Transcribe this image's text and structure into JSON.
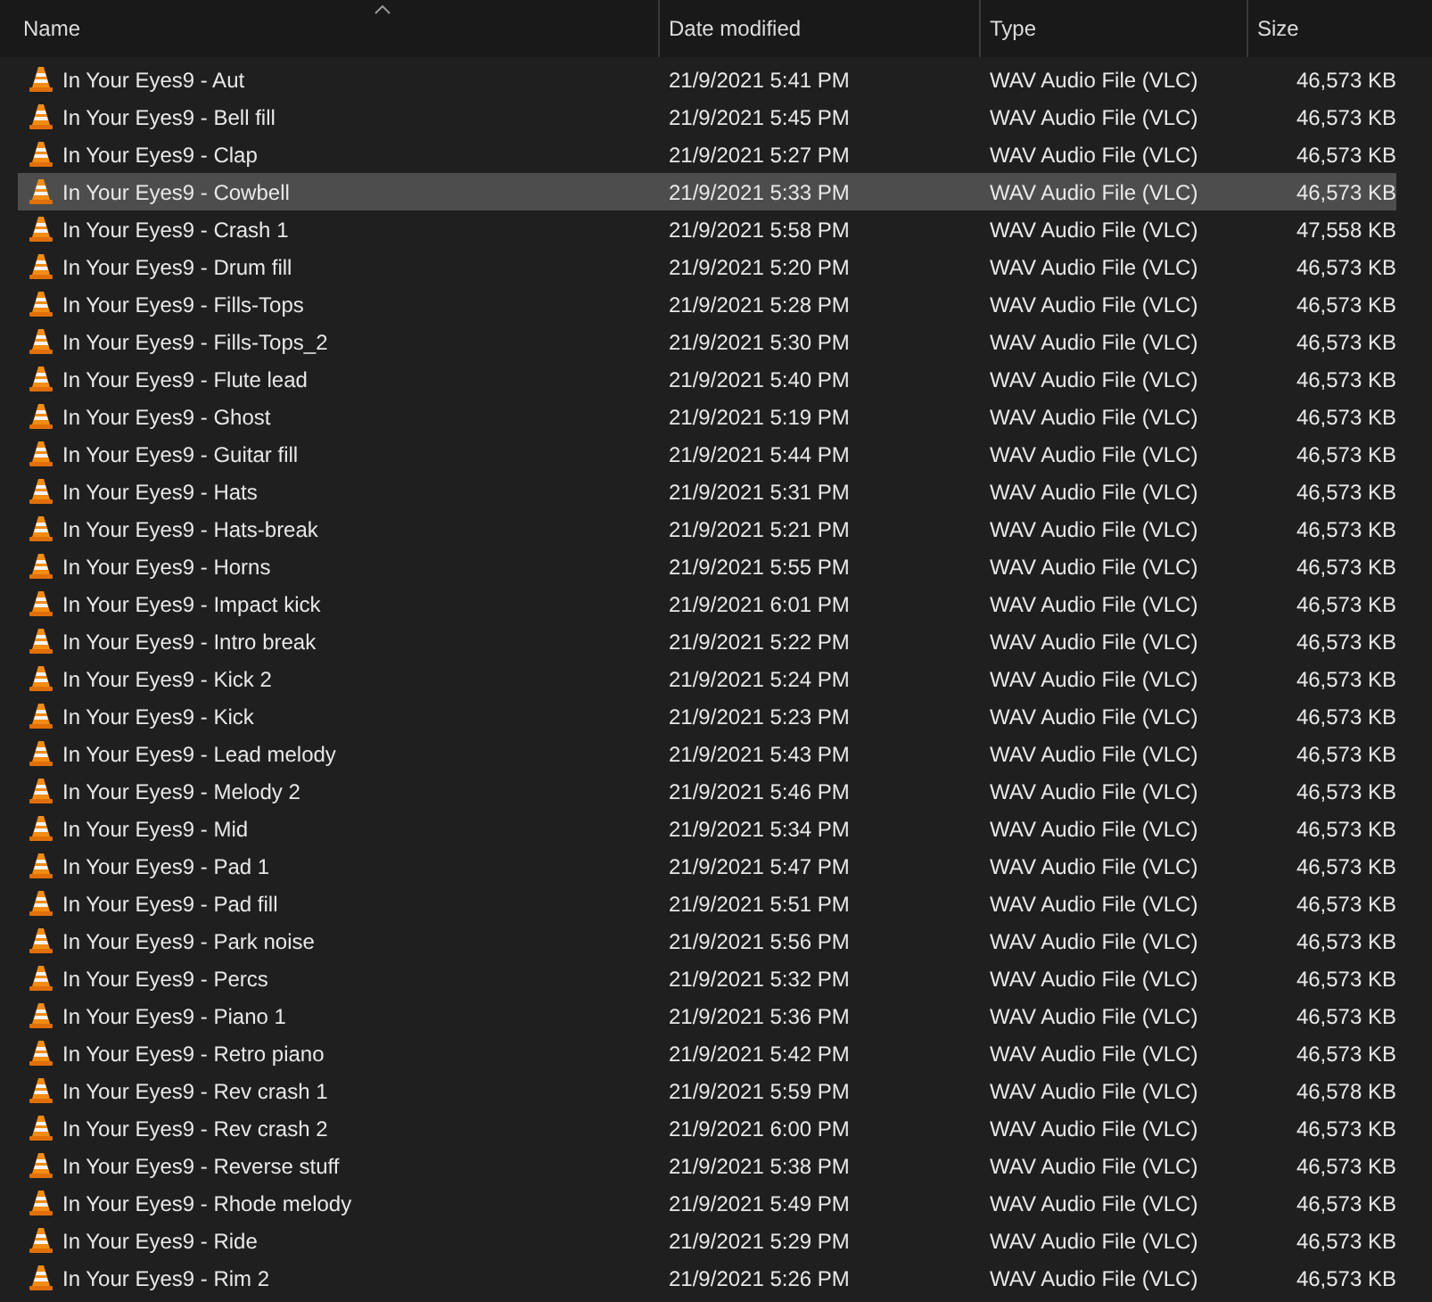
{
  "columns": [
    {
      "label": "Name",
      "sorted": true
    },
    {
      "label": "Date modified",
      "sorted": false
    },
    {
      "label": "Type",
      "sorted": false
    },
    {
      "label": "Size",
      "sorted": false
    }
  ],
  "rows": [
    {
      "name": "In Your Eyes9 - Aut",
      "date": "21/9/2021 5:41 PM",
      "type": "WAV Audio File (VLC)",
      "size": "46,573 KB",
      "selected": false
    },
    {
      "name": "In Your Eyes9 - Bell fill",
      "date": "21/9/2021 5:45 PM",
      "type": "WAV Audio File (VLC)",
      "size": "46,573 KB",
      "selected": false
    },
    {
      "name": "In Your Eyes9 - Clap",
      "date": "21/9/2021 5:27 PM",
      "type": "WAV Audio File (VLC)",
      "size": "46,573 KB",
      "selected": false
    },
    {
      "name": "In Your Eyes9 - Cowbell",
      "date": "21/9/2021 5:33 PM",
      "type": "WAV Audio File (VLC)",
      "size": "46,573 KB",
      "selected": true
    },
    {
      "name": "In Your Eyes9 - Crash 1",
      "date": "21/9/2021 5:58 PM",
      "type": "WAV Audio File (VLC)",
      "size": "47,558 KB",
      "selected": false
    },
    {
      "name": "In Your Eyes9 - Drum fill",
      "date": "21/9/2021 5:20 PM",
      "type": "WAV Audio File (VLC)",
      "size": "46,573 KB",
      "selected": false
    },
    {
      "name": "In Your Eyes9 - Fills-Tops",
      "date": "21/9/2021 5:28 PM",
      "type": "WAV Audio File (VLC)",
      "size": "46,573 KB",
      "selected": false
    },
    {
      "name": "In Your Eyes9 - Fills-Tops_2",
      "date": "21/9/2021 5:30 PM",
      "type": "WAV Audio File (VLC)",
      "size": "46,573 KB",
      "selected": false
    },
    {
      "name": "In Your Eyes9 - Flute lead",
      "date": "21/9/2021 5:40 PM",
      "type": "WAV Audio File (VLC)",
      "size": "46,573 KB",
      "selected": false
    },
    {
      "name": "In Your Eyes9 - Ghost",
      "date": "21/9/2021 5:19 PM",
      "type": "WAV Audio File (VLC)",
      "size": "46,573 KB",
      "selected": false
    },
    {
      "name": "In Your Eyes9 - Guitar fill",
      "date": "21/9/2021 5:44 PM",
      "type": "WAV Audio File (VLC)",
      "size": "46,573 KB",
      "selected": false
    },
    {
      "name": "In Your Eyes9 - Hats",
      "date": "21/9/2021 5:31 PM",
      "type": "WAV Audio File (VLC)",
      "size": "46,573 KB",
      "selected": false
    },
    {
      "name": "In Your Eyes9 - Hats-break",
      "date": "21/9/2021 5:21 PM",
      "type": "WAV Audio File (VLC)",
      "size": "46,573 KB",
      "selected": false
    },
    {
      "name": "In Your Eyes9 - Horns",
      "date": "21/9/2021 5:55 PM",
      "type": "WAV Audio File (VLC)",
      "size": "46,573 KB",
      "selected": false
    },
    {
      "name": "In Your Eyes9 - Impact kick",
      "date": "21/9/2021 6:01 PM",
      "type": "WAV Audio File (VLC)",
      "size": "46,573 KB",
      "selected": false
    },
    {
      "name": "In Your Eyes9 - Intro break",
      "date": "21/9/2021 5:22 PM",
      "type": "WAV Audio File (VLC)",
      "size": "46,573 KB",
      "selected": false
    },
    {
      "name": "In Your Eyes9 - Kick 2",
      "date": "21/9/2021 5:24 PM",
      "type": "WAV Audio File (VLC)",
      "size": "46,573 KB",
      "selected": false
    },
    {
      "name": "In Your Eyes9 - Kick",
      "date": "21/9/2021 5:23 PM",
      "type": "WAV Audio File (VLC)",
      "size": "46,573 KB",
      "selected": false
    },
    {
      "name": "In Your Eyes9 - Lead melody",
      "date": "21/9/2021 5:43 PM",
      "type": "WAV Audio File (VLC)",
      "size": "46,573 KB",
      "selected": false
    },
    {
      "name": "In Your Eyes9 - Melody 2",
      "date": "21/9/2021 5:46 PM",
      "type": "WAV Audio File (VLC)",
      "size": "46,573 KB",
      "selected": false
    },
    {
      "name": "In Your Eyes9 - Mid",
      "date": "21/9/2021 5:34 PM",
      "type": "WAV Audio File (VLC)",
      "size": "46,573 KB",
      "selected": false
    },
    {
      "name": "In Your Eyes9 - Pad 1",
      "date": "21/9/2021 5:47 PM",
      "type": "WAV Audio File (VLC)",
      "size": "46,573 KB",
      "selected": false
    },
    {
      "name": "In Your Eyes9 - Pad fill",
      "date": "21/9/2021 5:51 PM",
      "type": "WAV Audio File (VLC)",
      "size": "46,573 KB",
      "selected": false
    },
    {
      "name": "In Your Eyes9 - Park noise",
      "date": "21/9/2021 5:56 PM",
      "type": "WAV Audio File (VLC)",
      "size": "46,573 KB",
      "selected": false
    },
    {
      "name": "In Your Eyes9 - Percs",
      "date": "21/9/2021 5:32 PM",
      "type": "WAV Audio File (VLC)",
      "size": "46,573 KB",
      "selected": false
    },
    {
      "name": "In Your Eyes9 - Piano 1",
      "date": "21/9/2021 5:36 PM",
      "type": "WAV Audio File (VLC)",
      "size": "46,573 KB",
      "selected": false
    },
    {
      "name": "In Your Eyes9 - Retro piano",
      "date": "21/9/2021 5:42 PM",
      "type": "WAV Audio File (VLC)",
      "size": "46,573 KB",
      "selected": false
    },
    {
      "name": "In Your Eyes9 - Rev crash 1",
      "date": "21/9/2021 5:59 PM",
      "type": "WAV Audio File (VLC)",
      "size": "46,578 KB",
      "selected": false
    },
    {
      "name": "In Your Eyes9 - Rev crash 2",
      "date": "21/9/2021 6:00 PM",
      "type": "WAV Audio File (VLC)",
      "size": "46,573 KB",
      "selected": false
    },
    {
      "name": "In Your Eyes9 - Reverse stuff",
      "date": "21/9/2021 5:38 PM",
      "type": "WAV Audio File (VLC)",
      "size": "46,573 KB",
      "selected": false
    },
    {
      "name": "In Your Eyes9 - Rhode melody",
      "date": "21/9/2021 5:49 PM",
      "type": "WAV Audio File (VLC)",
      "size": "46,573 KB",
      "selected": false
    },
    {
      "name": "In Your Eyes9 - Ride",
      "date": "21/9/2021 5:29 PM",
      "type": "WAV Audio File (VLC)",
      "size": "46,573 KB",
      "selected": false
    },
    {
      "name": "In Your Eyes9 - Rim 2",
      "date": "21/9/2021 5:26 PM",
      "type": "WAV Audio File (VLC)",
      "size": "46,573 KB",
      "selected": false
    }
  ]
}
